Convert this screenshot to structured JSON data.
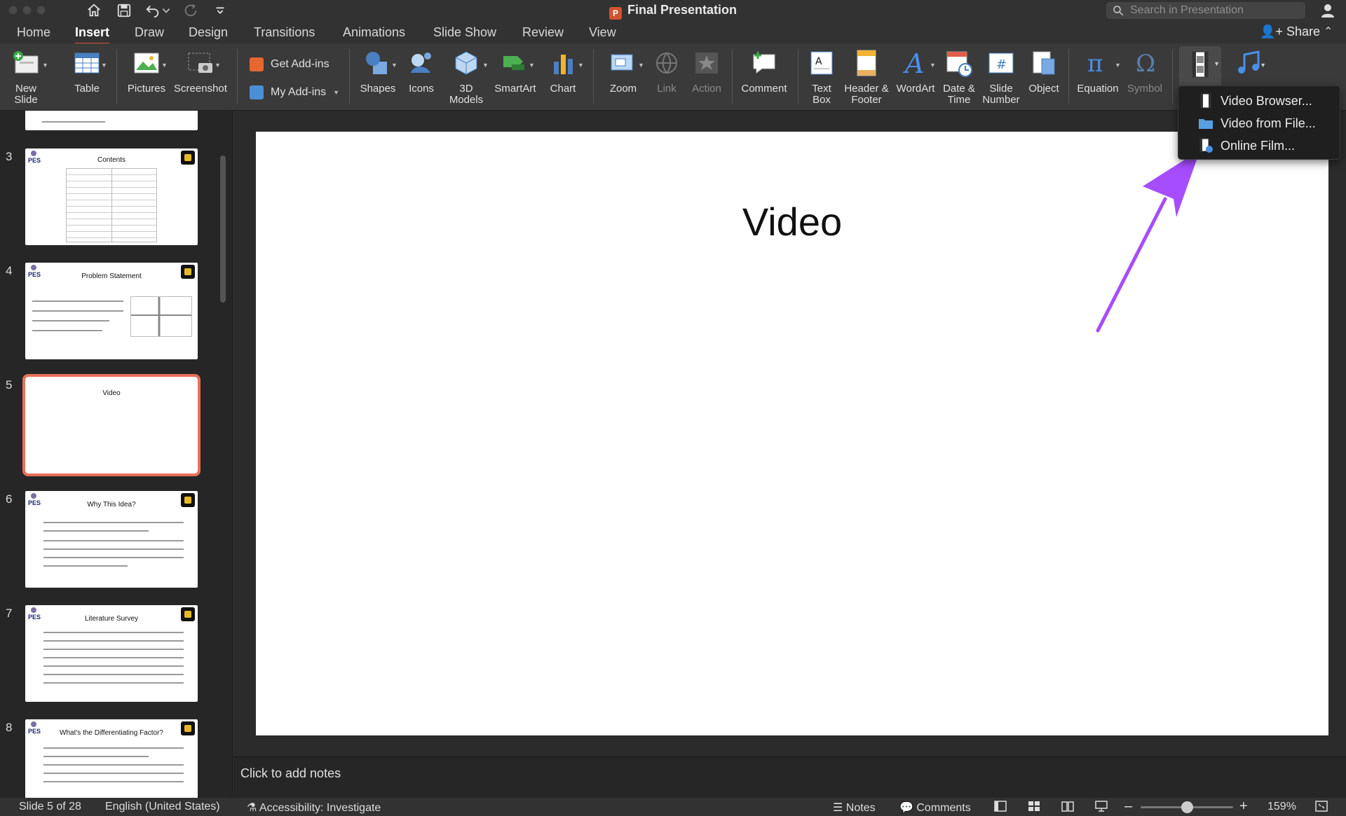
{
  "window": {
    "title": "Final Presentation",
    "search_placeholder": "Search in Presentation"
  },
  "tabs": [
    "Home",
    "Insert",
    "Draw",
    "Design",
    "Transitions",
    "Animations",
    "Slide Show",
    "Review",
    "View"
  ],
  "active_tab": "Insert",
  "share_label": "Share",
  "ribbon": {
    "new_slide": "New Slide",
    "table": "Table",
    "pictures": "Pictures",
    "screenshot": "Screenshot",
    "get_addins": "Get Add-ins",
    "my_addins": "My Add-ins",
    "shapes": "Shapes",
    "icons": "Icons",
    "models_3d": "3D Models",
    "smartart": "SmartArt",
    "chart": "Chart",
    "zoom": "Zoom",
    "link": "Link",
    "action": "Action",
    "comment": "Comment",
    "text_box": "Text Box",
    "header_footer": "Header & Footer",
    "wordart": "WordArt",
    "date_time": "Date & Time",
    "slide_number": "Slide Number",
    "object": "Object",
    "equation": "Equation",
    "symbol": "Symbol"
  },
  "video_menu": {
    "items": [
      "Video Browser...",
      "Video from File...",
      "Online Film..."
    ]
  },
  "thumbnails": [
    {
      "number": "3",
      "title": "Contents"
    },
    {
      "number": "4",
      "title": "Problem Statement"
    },
    {
      "number": "5",
      "title": "Video"
    },
    {
      "number": "6",
      "title": "Why This Idea?"
    },
    {
      "number": "7",
      "title": "Literature Survey"
    },
    {
      "number": "8",
      "title": "What's the Differentiating Factor?"
    }
  ],
  "slide": {
    "title": "Video"
  },
  "notes_placeholder": "Click to add notes",
  "status": {
    "slide_position": "Slide 5 of 28",
    "language": "English (United States)",
    "accessibility": "Accessibility: Investigate",
    "notes": "Notes",
    "comments": "Comments",
    "zoom": "159%",
    "zoom_level": 0.5
  },
  "colors": {
    "accent": "#d35230",
    "arrow": "#a64dff",
    "selection": "#e8705a"
  }
}
